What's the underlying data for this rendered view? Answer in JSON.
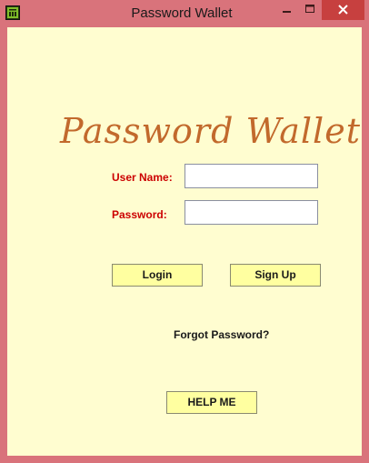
{
  "window": {
    "title": "Password Wallet",
    "icon": "app-icon",
    "controls": [
      "minimize-icon",
      "maximize-icon",
      "close-icon"
    ]
  },
  "colors": {
    "frame": "#d9737b",
    "client_bg": "#fffdd0",
    "close_button": "#c7403f",
    "logo_text": "#c2692c",
    "label_text": "#cc0000",
    "button_bg": "#ffffa0"
  },
  "logo": {
    "text": "Password Wallet"
  },
  "form": {
    "username_label": "User Name:",
    "username_value": "",
    "password_label": "Password:",
    "password_value": ""
  },
  "buttons": {
    "login": "Login",
    "signup": "Sign Up",
    "help": "HELP ME"
  },
  "links": {
    "forgot_password": "Forgot Password?"
  }
}
